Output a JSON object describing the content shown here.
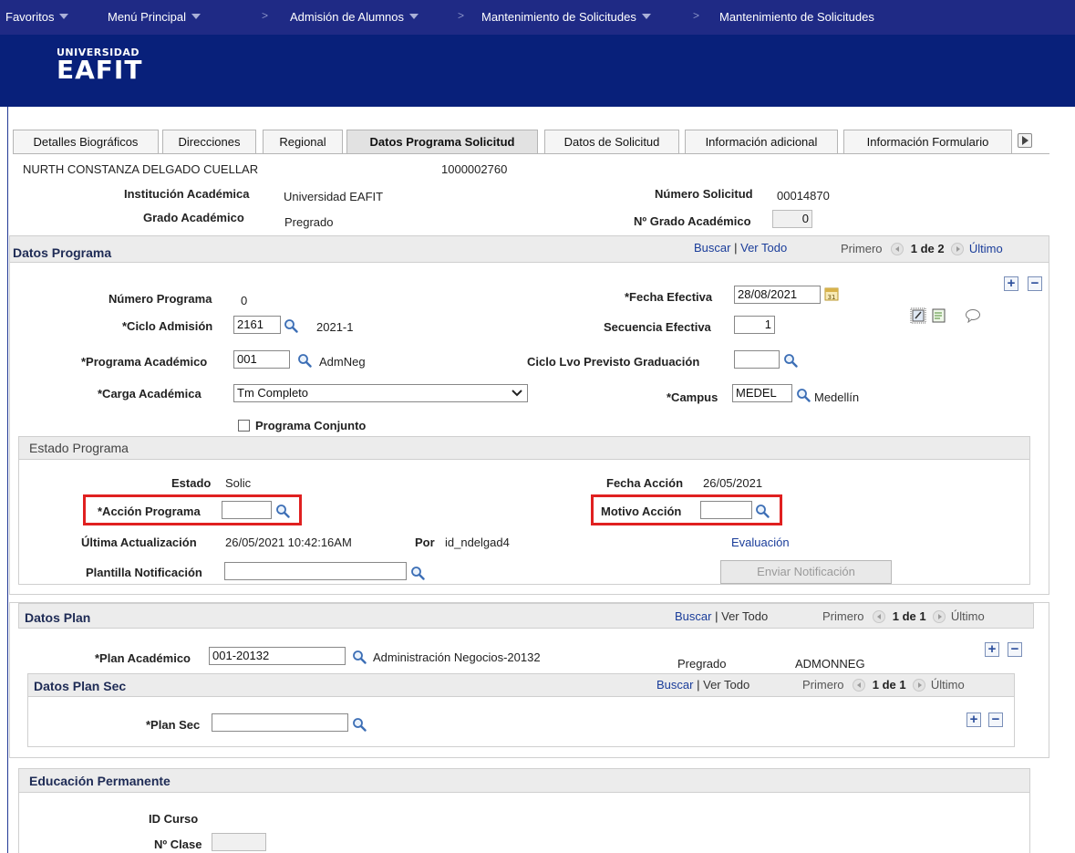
{
  "topnav": {
    "favoritos": "Favoritos",
    "menu_principal": "Menú Principal",
    "admision": "Admisión de Alumnos",
    "mantenimiento1": "Mantenimiento de Solicitudes",
    "mantenimiento2": "Mantenimiento de Solicitudes"
  },
  "logo": {
    "line1": "UNIVERSIDAD",
    "line2": "EAFIT"
  },
  "tabs": [
    "Detalles Biográficos",
    "Direcciones",
    "Regional",
    "Datos Programa Solicitud",
    "Datos de Solicitud",
    "Información adicional",
    "Información Formulario"
  ],
  "header": {
    "name": "NURTH CONSTANZA DELGADO CUELLAR",
    "id": "1000002760",
    "institucion_label": "Institución Académica",
    "institucion_value": "Universidad EAFIT",
    "grado_label": "Grado Académico",
    "grado_value": "Pregrado",
    "num_solicitud_label": "Número Solicitud",
    "num_solicitud_value": "00014870",
    "num_grado_label": "Nº Grado Académico",
    "num_grado_value": "0"
  },
  "datos_programa": {
    "title": "Datos Programa",
    "buscar": "Buscar",
    "sep": "|",
    "ver_todo": "Ver Todo",
    "primero": "Primero",
    "pager": "1 de 2",
    "ultimo": "Último",
    "numero_programa_label": "Número Programa",
    "numero_programa_value": "0",
    "fecha_efectiva_label": "*Fecha Efectiva",
    "fecha_efectiva_value": "28/08/2021",
    "ciclo_admision_label": "*Ciclo Admisión",
    "ciclo_admision_value": "2161",
    "ciclo_admision_desc": "2021-1",
    "secuencia_label": "Secuencia Efectiva",
    "secuencia_value": "1",
    "programa_academico_label": "*Programa Académico",
    "programa_academico_value": "001",
    "programa_academico_desc": "AdmNeg",
    "ciclo_grad_label": "Ciclo Lvo Previsto Graduación",
    "ciclo_grad_value": "",
    "carga_label": "*Carga Académica",
    "carga_value": "Tm Completo",
    "campus_label": "*Campus",
    "campus_value": "MEDEL",
    "campus_desc": "Medellín",
    "programa_conjunto_label": "Programa Conjunto"
  },
  "estado_programa": {
    "title": "Estado Programa",
    "estado_label": "Estado",
    "estado_value": "Solic",
    "fecha_accion_label": "Fecha Acción",
    "fecha_accion_value": "26/05/2021",
    "accion_label": "*Acción Programa",
    "accion_value": "",
    "motivo_label": "Motivo Acción",
    "motivo_value": "",
    "ultima_label": "Última Actualización",
    "ultima_value": "26/05/2021 10:42:16AM",
    "por_label": "Por",
    "por_value": "id_ndelgad4",
    "evaluacion": "Evaluación",
    "plantilla_label": "Plantilla Notificación",
    "plantilla_value": "",
    "enviar": "Enviar Notificación"
  },
  "datos_plan": {
    "title": "Datos Plan",
    "buscar": "Buscar",
    "sep": "|",
    "ver_todo": "Ver Todo",
    "primero": "Primero",
    "pager": "1 de 1",
    "ultimo": "Último",
    "plan_label": "*Plan Académico",
    "plan_value": "001-20132",
    "plan_desc": "Administración Negocios-20132",
    "plan_grado": "Pregrado",
    "plan_code": "ADMONNEG"
  },
  "datos_plan_sec": {
    "title": "Datos Plan Sec",
    "buscar": "Buscar",
    "sep": "|",
    "ver_todo": "Ver Todo",
    "primero": "Primero",
    "pager": "1 de 1",
    "ultimo": "Último",
    "plan_sec_label": "*Plan Sec",
    "plan_sec_value": ""
  },
  "educacion": {
    "title": "Educación Permanente",
    "id_curso_label": "ID Curso",
    "num_clase_label": "Nº Clase",
    "num_clase_value": ""
  },
  "colors": {
    "nav": "#1f2a85",
    "banner": "#08207a",
    "link": "#1a3d9a",
    "highlight": "#e02020"
  }
}
